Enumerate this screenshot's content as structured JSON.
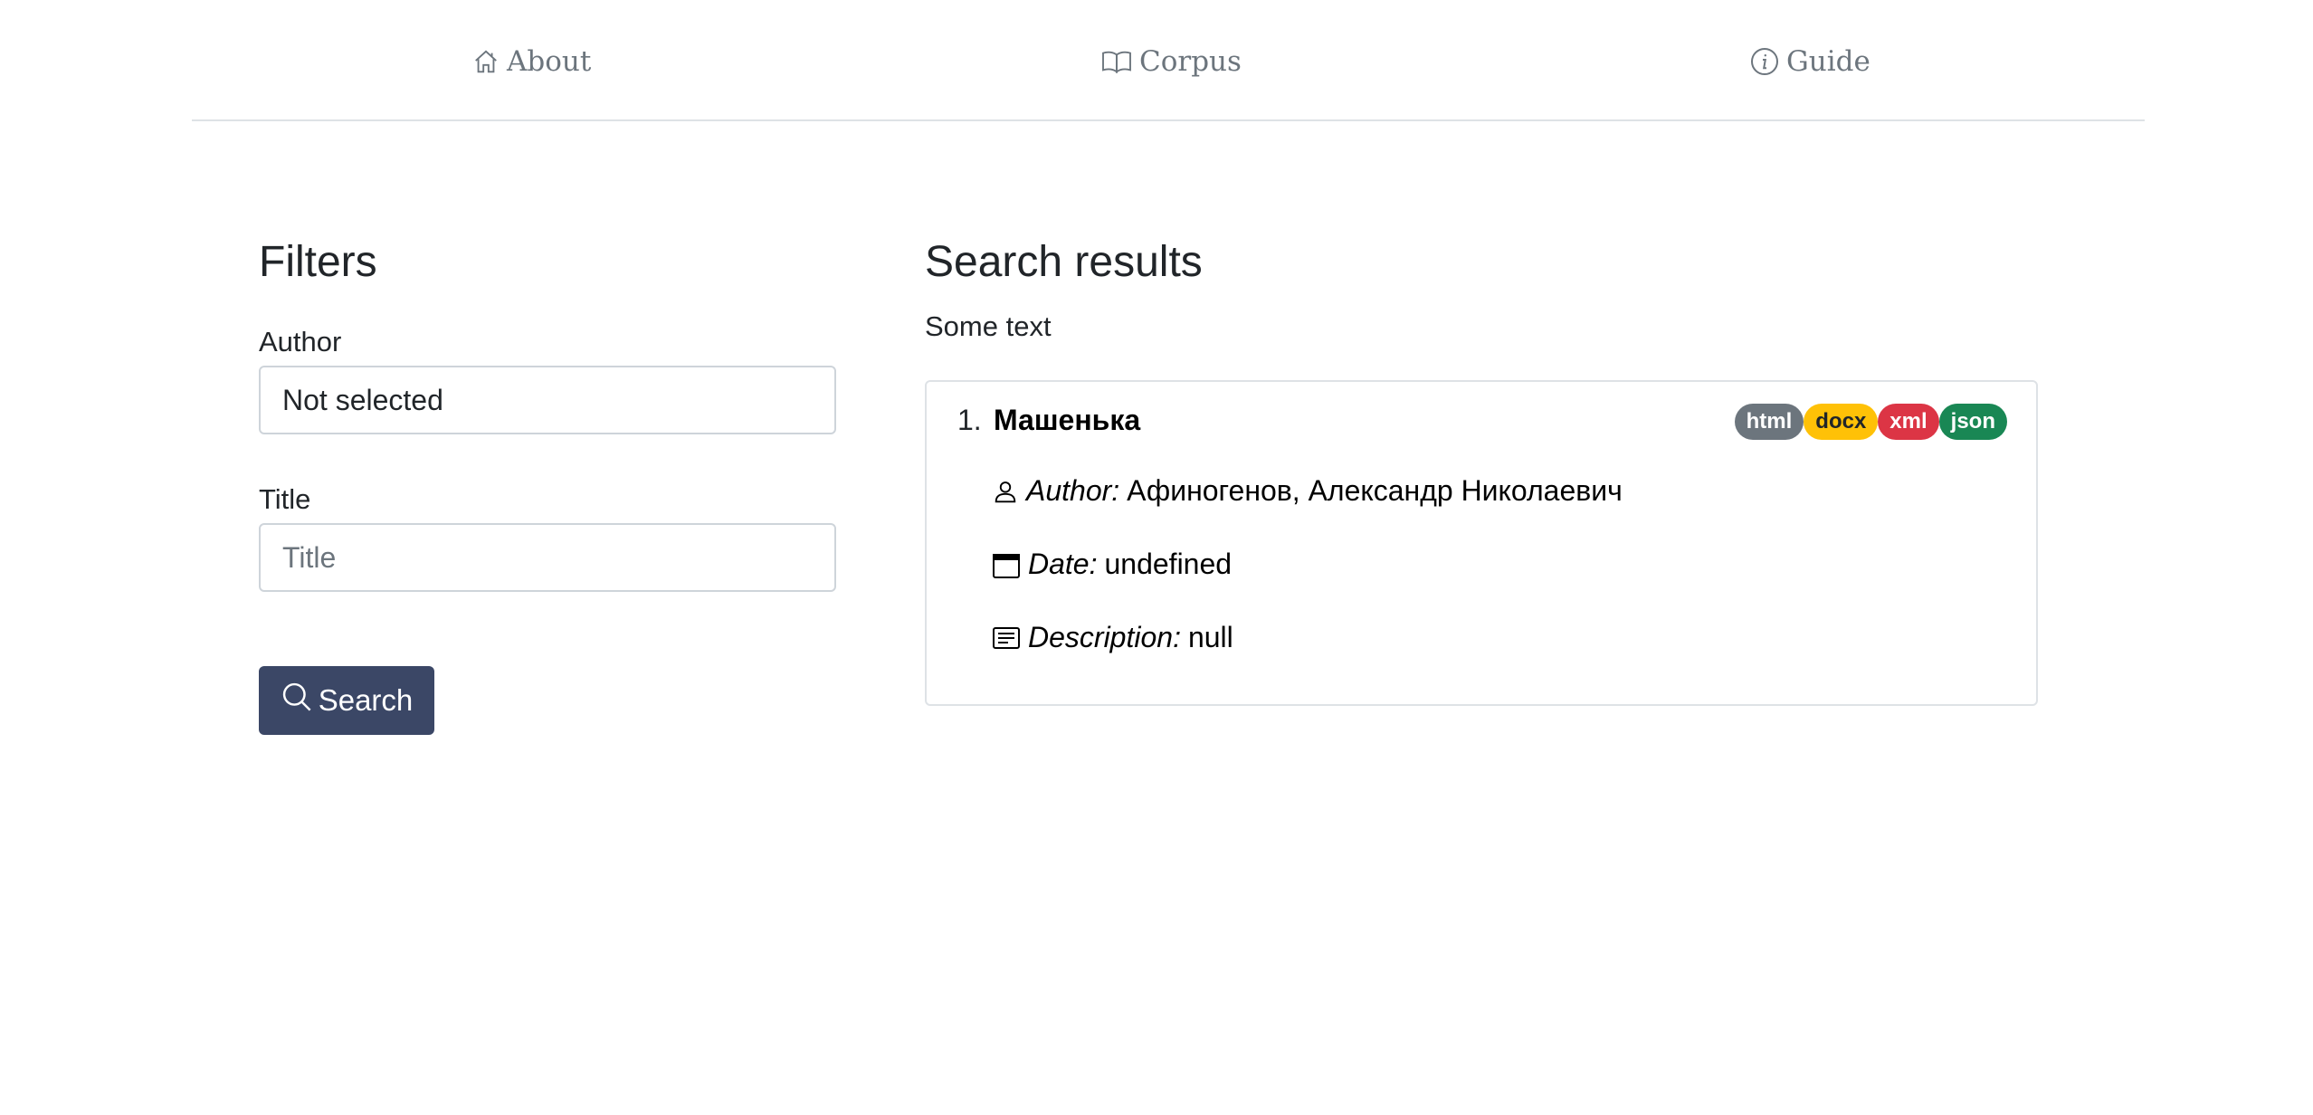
{
  "nav": {
    "about": "About",
    "corpus": "Corpus",
    "guide": "Guide"
  },
  "filters": {
    "title": "Filters",
    "author_label": "Author",
    "author_value": "Not selected",
    "title_label": "Title",
    "title_placeholder": "Title",
    "search_button": "Search"
  },
  "results": {
    "title": "Search results",
    "subtitle": "Some text",
    "items": [
      {
        "index": "1.",
        "title": "Машенька",
        "formats": [
          "html",
          "docx",
          "xml",
          "json"
        ],
        "author_key": "Author:",
        "author_value": "Афиногенов, Александр Николаевич",
        "date_key": "Date:",
        "date_value": "undefined",
        "description_key": "Description:",
        "description_value": "null"
      }
    ]
  },
  "colors": {
    "primary_button": "#3b4766",
    "badge_html": "#6c757d",
    "badge_docx": "#ffc107",
    "badge_xml": "#dc3545",
    "badge_json": "#198754"
  }
}
